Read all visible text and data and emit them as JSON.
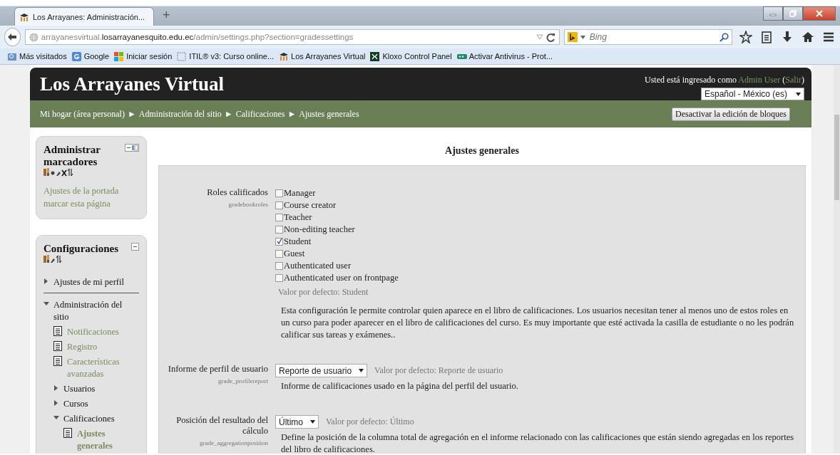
{
  "browser": {
    "tab": {
      "title": "Los Arrayanes: Administración...",
      "selected": true
    },
    "new_tab": "+",
    "url": [
      {
        "kind": "dim",
        "text": "arrayanesvirtual."
      },
      {
        "kind": "host",
        "text": "losarrayanesquito.edu.ec"
      },
      {
        "kind": "dim",
        "text": "/admin/settings.php?section=gradessettings"
      }
    ],
    "search": {
      "placeholder": "Bing"
    },
    "bookmarks": [
      {
        "label": "Más visitados"
      },
      {
        "label": "Google"
      },
      {
        "label": "Iniciar sesión"
      },
      {
        "label": "ITIL® v3: Curso online..."
      },
      {
        "label": "Los Arrayanes Virtual"
      },
      {
        "label": "Kloxo Control Panel"
      },
      {
        "label": "Activar Antivirus - Prot..."
      }
    ]
  },
  "site": {
    "title": "Los Arrayanes Virtual",
    "login": [
      {
        "kind": "text",
        "text": "Usted está ingresado como "
      },
      {
        "kind": "link",
        "text": "Admin User"
      },
      {
        "kind": "text",
        "text": " ("
      },
      {
        "kind": "link",
        "text": "Salir"
      },
      {
        "kind": "text",
        "text": ")"
      }
    ],
    "language": "Español - México (es)",
    "breadcrumb": {
      "separator": "►",
      "items": [
        "Mi hogar (área personal)",
        "Administración del sitio",
        "Calificaciones",
        "Ajustes generales"
      ]
    },
    "edit_button": "Desactivar la edición de bloques"
  },
  "blocks": [
    {
      "kind": "links",
      "title": "Administrar marcadores",
      "links": [
        "Ajustes de la portada",
        "marcar esta página"
      ]
    },
    {
      "kind": "tree",
      "title": "Configuraciones",
      "items": [
        {
          "label": "Ajustes de mi perfil",
          "kind": "branch",
          "expanded": false
        },
        {
          "label": "Administración del sitio",
          "kind": "branch",
          "expanded": true,
          "children": [
            {
              "label": "Notificaciones",
              "kind": "page",
              "selected": false
            },
            {
              "label": "Registro",
              "kind": "page",
              "selected": false
            },
            {
              "label": "Características avanzadas",
              "kind": "page",
              "selected": false
            },
            {
              "label": "Usuarios",
              "kind": "branch",
              "expanded": false
            },
            {
              "label": "Cursos",
              "kind": "branch",
              "expanded": false
            },
            {
              "label": "Calificaciones",
              "kind": "branch",
              "expanded": true,
              "children": [
                {
                  "label": "Ajustes generales",
                  "kind": "page",
                  "selected": true
                }
              ]
            }
          ]
        }
      ]
    }
  ],
  "main": {
    "title": "Ajustes generales",
    "settings": [
      {
        "kind": "checkboxes",
        "label": "Roles calificados",
        "name": "gradebookroles",
        "options": [
          {
            "label": "Manager",
            "checked": false
          },
          {
            "label": "Course creator",
            "checked": false
          },
          {
            "label": "Teacher",
            "checked": false
          },
          {
            "label": "Non-editing teacher",
            "checked": false
          },
          {
            "label": "Student",
            "checked": true
          },
          {
            "label": "Guest",
            "checked": false
          },
          {
            "label": "Authenticated user",
            "checked": false
          },
          {
            "label": "Authenticated user on frontpage",
            "checked": false
          }
        ],
        "default": "Valor por defecto: Student",
        "description": "Esta configuración le permite controlar quien aparece en el libro de calificaciones. Los usuarios necesitan tener al menos uno de estos roles en un curso para poder aparecer en el libro de calificaciones del curso. Es muy importante que esté activada la casilla de estudiante o no les podrán calificar sus tareas y exámenes.."
      },
      {
        "kind": "select",
        "label": "Informe de perfil de usuario",
        "name": "grade_profilereport",
        "value": "Reporte de usuario",
        "default": "Valor por defecto: Reporte de usuario",
        "description": "Informe de calificaciones usado en la página del perfil del usuario."
      },
      {
        "kind": "select",
        "label": "Posición del resultado del cálculo",
        "name": "grade_aggregationposition",
        "value": "Último",
        "default": "Valor por defecto: Último",
        "description": "Define la posición de la columna total de agregación en el informe relacionado con las calificaciones que están siendo agregadas en los reportes del libro de calificaciones."
      }
    ]
  }
}
